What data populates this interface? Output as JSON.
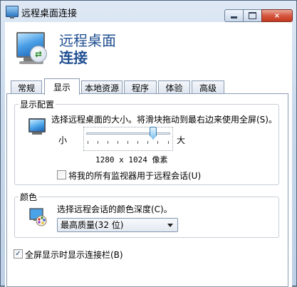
{
  "window": {
    "title": "远程桌面连接",
    "controls": {
      "minimize": "minimize",
      "maximize": "maximize",
      "close": "×"
    }
  },
  "banner": {
    "line1": "远程桌面",
    "line2": "连接"
  },
  "tabs": [
    {
      "label": "常规",
      "active": false
    },
    {
      "label": "显示",
      "active": true
    },
    {
      "label": "本地资源",
      "active": false
    },
    {
      "label": "程序",
      "active": false
    },
    {
      "label": "体验",
      "active": false
    },
    {
      "label": "高级",
      "active": false
    }
  ],
  "display_config": {
    "group_title": "显示配置",
    "description": "选择远程桌面的大小。将滑块拖动到最右边来使用全屏(S)。",
    "slider": {
      "min_label": "小",
      "max_label": "大",
      "value_fraction": 0.83
    },
    "resolution": "1280 x 1024 像素",
    "all_monitors_checkbox": {
      "label": "将我的所有监视器用于远程会话(U)",
      "checked": false
    }
  },
  "colors": {
    "group_title": "颜色",
    "description": "选择远程会话的颜色深度(C)。",
    "depth_select": {
      "value": "最高质量(32 位)"
    }
  },
  "fullscreen_bar_checkbox": {
    "label": "全屏显示时显示连接栏(B)",
    "checked": true
  },
  "theme": {
    "title_color": "#1f4e91",
    "close_red": "#c4391f"
  }
}
